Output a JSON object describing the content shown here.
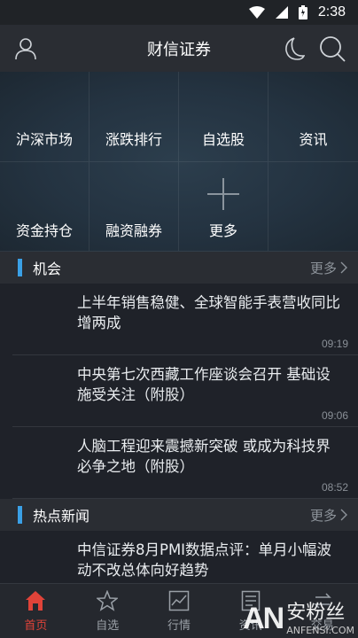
{
  "status_bar": {
    "time": "2:38"
  },
  "header": {
    "title": "财信证券",
    "icons": [
      "user-icon",
      "moon-icon",
      "search-icon"
    ]
  },
  "grid": {
    "items": [
      {
        "label": "沪深市场"
      },
      {
        "label": "涨跌排行"
      },
      {
        "label": "自选股"
      },
      {
        "label": "资讯"
      },
      {
        "label": "资金持仓"
      },
      {
        "label": "融资融券"
      },
      {
        "label": "更多",
        "icon": "plus-icon"
      }
    ]
  },
  "sections": [
    {
      "title": "机会",
      "more": "更多",
      "accent": "#3aa0e6",
      "items": [
        {
          "headline": "上半年销售稳健、全球智能手表营收同比增两成",
          "time": "09:19"
        },
        {
          "headline": "中央第七次西藏工作座谈会召开 基础设施受关注（附股）",
          "time": "09:06"
        },
        {
          "headline": "人脑工程迎来震撼新突破 或成为科技界必争之地（附股）",
          "time": "08:52"
        }
      ]
    },
    {
      "title": "热点新闻",
      "more": "更多",
      "accent": "#3aa0e6",
      "items": [
        {
          "headline": "中信证券8月PMI数据点评：单月小幅波动不改总体向好趋势",
          "time": ""
        }
      ]
    }
  ],
  "tabbar": {
    "active_color": "#e04339",
    "tabs": [
      {
        "label": "首页",
        "icon": "home-icon",
        "active": true
      },
      {
        "label": "自选",
        "icon": "star-icon",
        "active": false
      },
      {
        "label": "行情",
        "icon": "chart-icon",
        "active": false
      },
      {
        "label": "资讯",
        "icon": "document-icon",
        "active": false
      },
      {
        "label": "交易",
        "icon": "trade-icon",
        "active": false
      }
    ]
  },
  "watermark": {
    "logo": "AN",
    "cn": "安粉丝",
    "en": "ANFENSI.COM"
  }
}
